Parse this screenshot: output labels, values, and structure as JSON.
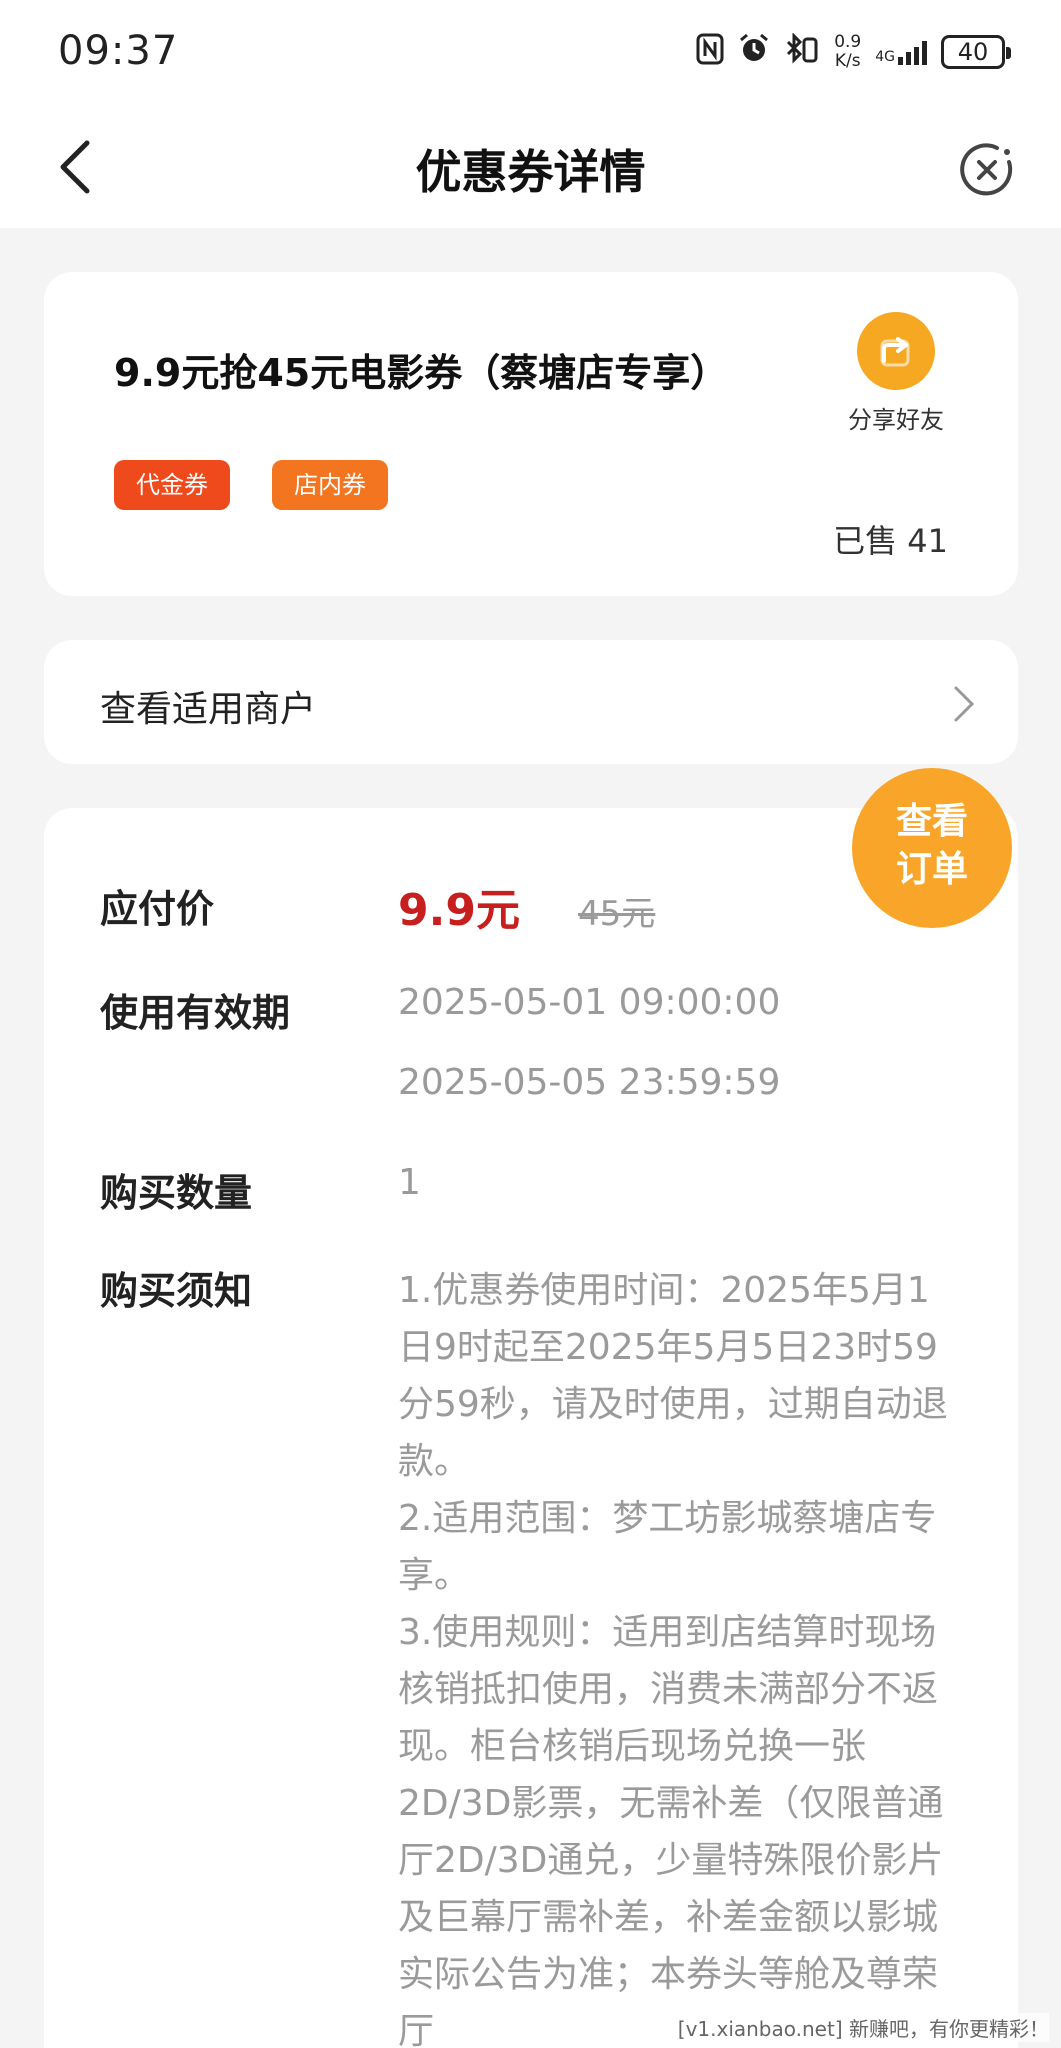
{
  "status_bar": {
    "time": "09:37",
    "net_speed_value": "0.9",
    "net_speed_unit": "K/s",
    "net_type": "4G",
    "battery": "40"
  },
  "nav": {
    "title": "优惠券详情"
  },
  "coupon": {
    "title": "9.9元抢45元电影券（蔡塘店专享）",
    "share_label": "分享好友",
    "tags": [
      "代金券",
      "店内券"
    ],
    "sold": "已售 41"
  },
  "merchant": {
    "label": "查看适用商户"
  },
  "order_button": {
    "line1": "查看",
    "line2": "订单"
  },
  "detail": {
    "price_label": "应付价",
    "price_now": "9.9元",
    "price_original": "45元",
    "validity_label": "使用有效期",
    "validity_start": "2025-05-01 09:00:00",
    "validity_end": "2025-05-05 23:59:59",
    "quantity_label": "购买数量",
    "quantity": "1",
    "notice_label": "购买须知",
    "notice_items": [
      "1.优惠券使用时间：2025年5月1日9时起至2025年5月5日23时59分59秒，请及时使用，过期自动退款。",
      "2.适用范围：梦工坊影城蔡塘店专享。",
      "3.使用规则：适用到店结算时现场核销抵扣使用，消费未满部分不返现。柜台核销后现场兑换一张2D/3D影票，无需补差（仅限普通厅2D/3D通兑，少量特殊限价影片及巨幕厅需补差，补差金额以影城实际公告为准；本券头等舱及尊荣厅"
    ]
  },
  "watermark": "[v1.xianbao.net] 新赚吧，有你更精彩！",
  "colors": {
    "accent_orange": "#f6a823",
    "price_red": "#c71e1e",
    "tag_voucher": "#ef4a1c",
    "tag_instore": "#f4751f"
  },
  "icons": [
    "back-arrow-icon",
    "close-icon",
    "share-icon",
    "chevron-right-icon",
    "nfc-icon",
    "alarm-icon",
    "bluetooth-icon",
    "signal-icon",
    "battery-icon"
  ]
}
